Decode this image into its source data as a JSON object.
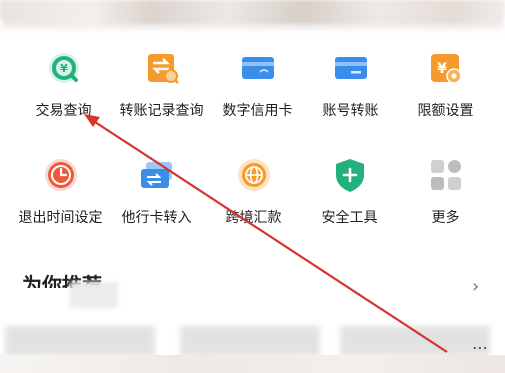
{
  "services_row1": [
    {
      "label": "交易查询",
      "icon": "search-coin-icon"
    },
    {
      "label": "转账记录查询",
      "icon": "transfer-record-icon"
    },
    {
      "label": "数字信用卡",
      "icon": "credit-card-icon"
    },
    {
      "label": "账号转账",
      "icon": "account-transfer-icon"
    },
    {
      "label": "限额设置",
      "icon": "limit-settings-icon"
    }
  ],
  "services_row2": [
    {
      "label": "退出时间设定",
      "icon": "clock-icon"
    },
    {
      "label": "他行卡转入",
      "icon": "card-transfer-in-icon"
    },
    {
      "label": "跨境汇款",
      "icon": "globe-icon"
    },
    {
      "label": "安全工具",
      "icon": "shield-plus-icon"
    },
    {
      "label": "更多",
      "icon": "grid-more-icon"
    }
  ],
  "recommend": {
    "title": "为你推荐"
  },
  "colors": {
    "green": "#22b07d",
    "orange": "#f59a2c",
    "blue": "#3a8de8",
    "red_orange": "#ef5a3c",
    "annotation_arrow": "#d8332e"
  }
}
